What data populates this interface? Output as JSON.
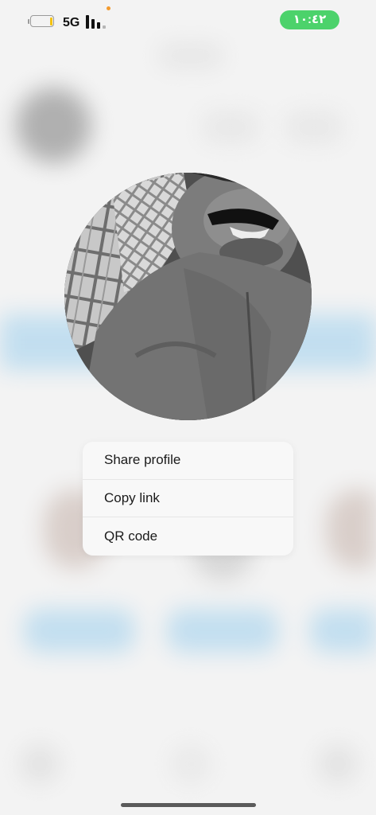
{
  "status_bar": {
    "network": "5G",
    "time": "١٠:٤٢",
    "battery_level_percent": 10,
    "signal_bars": 3
  },
  "colors": {
    "time_pill": "#4cd26b",
    "battery_fill": "#f4c20d",
    "privacy_dot": "#f39a2d",
    "menu_background": "#f8f8f8",
    "text": "#1a1a1a"
  },
  "profile_photo": {
    "description_icon": "profile-photo"
  },
  "context_menu": {
    "items": [
      {
        "label": "Share profile"
      },
      {
        "label": "Copy link"
      },
      {
        "label": "QR code"
      }
    ]
  }
}
